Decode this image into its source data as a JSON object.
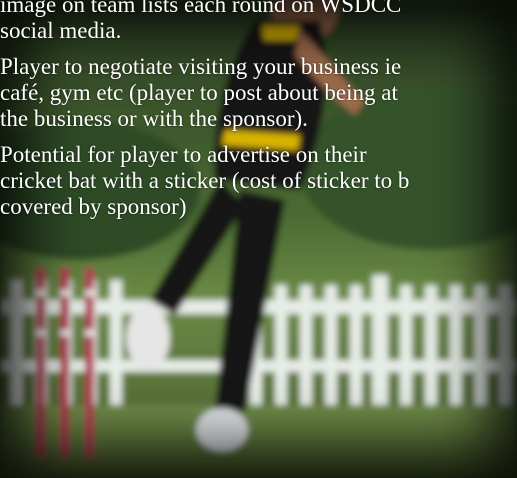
{
  "slide": {
    "paragraphs": [
      {
        "lines": [
          "image on team lists each round on WSDCC",
          "social media."
        ]
      },
      {
        "lines": [
          "Player to negotiate visiting your business ie",
          "café, gym etc (player to post about being at",
          "the business or with the sponsor)."
        ]
      },
      {
        "lines": [
          "Potential for player to advertise on their",
          "cricket bat with a sticker (cost of sticker to b",
          "covered by sponsor)"
        ]
      }
    ],
    "background": {
      "description_icon": "cricket-bowler-photo",
      "colors": {
        "sky": "#2f4a2a",
        "fence": "#e8eee8",
        "grass": "#5c7a3a",
        "kit_black": "#111111",
        "kit_gold": "#d8b400",
        "stumps": "#a2344c"
      }
    }
  }
}
